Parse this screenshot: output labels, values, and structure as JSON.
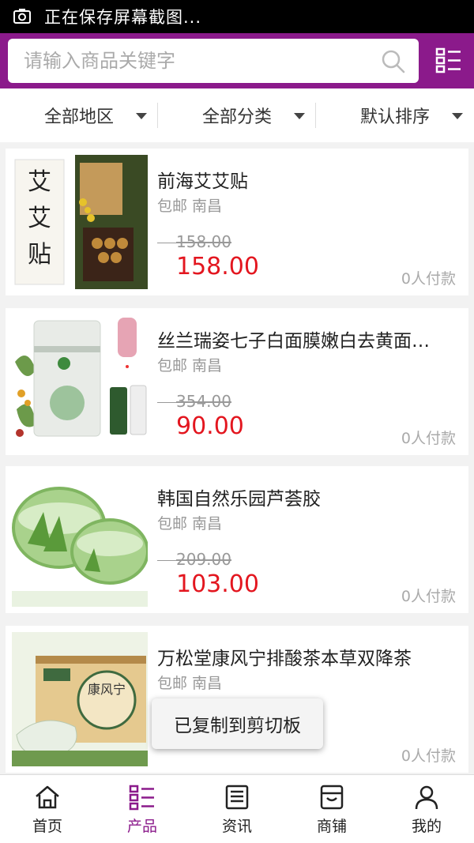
{
  "status_bar": {
    "text": "正在保存屏幕截图..."
  },
  "search": {
    "placeholder": "请输入商品关键字"
  },
  "filters": [
    {
      "label": "全部地区"
    },
    {
      "label": "全部分类"
    },
    {
      "label": "默认排序"
    }
  ],
  "products": [
    {
      "title": "前海艾艾贴",
      "shipping": "包邮",
      "city": "南昌",
      "old_price": "158.00",
      "price": "158.00",
      "sold": "0人付款",
      "thumb_text": "艾艾贴"
    },
    {
      "title": "丝兰瑞姿七子白面膜嫩白去黄面…",
      "shipping": "包邮",
      "city": "南昌",
      "old_price": "354.00",
      "price": "90.00",
      "sold": "0人付款"
    },
    {
      "title": "韩国自然乐园芦荟胶",
      "shipping": "包邮",
      "city": "南昌",
      "old_price": "209.00",
      "price": "103.00",
      "sold": "0人付款"
    },
    {
      "title": "万松堂康风宁排酸茶本草双降茶",
      "shipping": "包邮",
      "city": "南昌",
      "old_price": "",
      "price": "",
      "sold": "0人付款",
      "thumb_text": "康风宁"
    }
  ],
  "toast": {
    "text": "已复制到剪切板"
  },
  "tabbar": [
    {
      "label": "首页",
      "icon": "home-icon"
    },
    {
      "label": "产品",
      "icon": "list-icon",
      "active": true
    },
    {
      "label": "资讯",
      "icon": "news-icon"
    },
    {
      "label": "商铺",
      "icon": "shop-icon"
    },
    {
      "label": "我的",
      "icon": "user-icon"
    }
  ],
  "colors": {
    "brand": "#8b1a8b",
    "price": "#e3161f"
  }
}
